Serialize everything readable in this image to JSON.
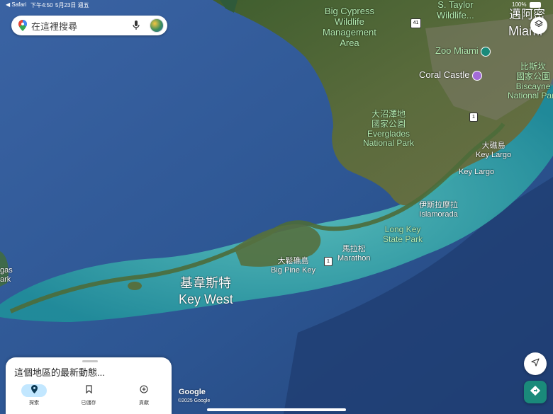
{
  "status_bar": {
    "back_label": "◀ Safari",
    "time": "下午4:50",
    "date": "5月23日 週五",
    "battery": "100%"
  },
  "search": {
    "placeholder": "在這裡搜尋"
  },
  "map_labels": {
    "big_cypress": "Big Cypress\nWildlife\nManagement\nArea",
    "s_taylor": "S. Taylor\nWildlife...",
    "miami_zh": "邁阿密",
    "miami": "Miami",
    "zoo_miami": "Zoo Miami",
    "coral_castle": "Coral Castle",
    "biscayne": "比斯坎\n國家公園\nBiscayne\nNational Park",
    "everglades": "大沼澤地\n國家公園\nEverglades\nNational Park",
    "key_largo_zh": "大礁島\nKey Largo",
    "key_largo": "Key Largo",
    "islamorada": "伊斯拉摩拉\nIslamorada",
    "long_key": "Long Key\nState Park",
    "marathon": "馬拉松\nMarathon",
    "big_pine": "大鬆礁島\nBig Pine Key",
    "key_west_zh": "基韋斯特",
    "key_west": "Key West",
    "vegas_partial": "gas\nark",
    "shield_41": "41",
    "shield_1a": "1",
    "shield_1b": "1"
  },
  "attribution": {
    "logo": "Google",
    "copyright": "©2025 Google"
  },
  "sheet": {
    "title": "這個地區的最新動態...",
    "tabs": [
      {
        "label": "探索",
        "icon": "location-pin-icon",
        "active": true
      },
      {
        "label": "已儲存",
        "icon": "bookmark-icon",
        "active": false
      },
      {
        "label": "貢獻",
        "icon": "add-circle-icon",
        "active": false
      }
    ]
  },
  "colors": {
    "ocean": "#2f5a9a",
    "reef": "#2ea3a8",
    "land": "#4e6a3a",
    "accent_green": "#1a8a7a",
    "active_tab": "#c2e7ff"
  }
}
